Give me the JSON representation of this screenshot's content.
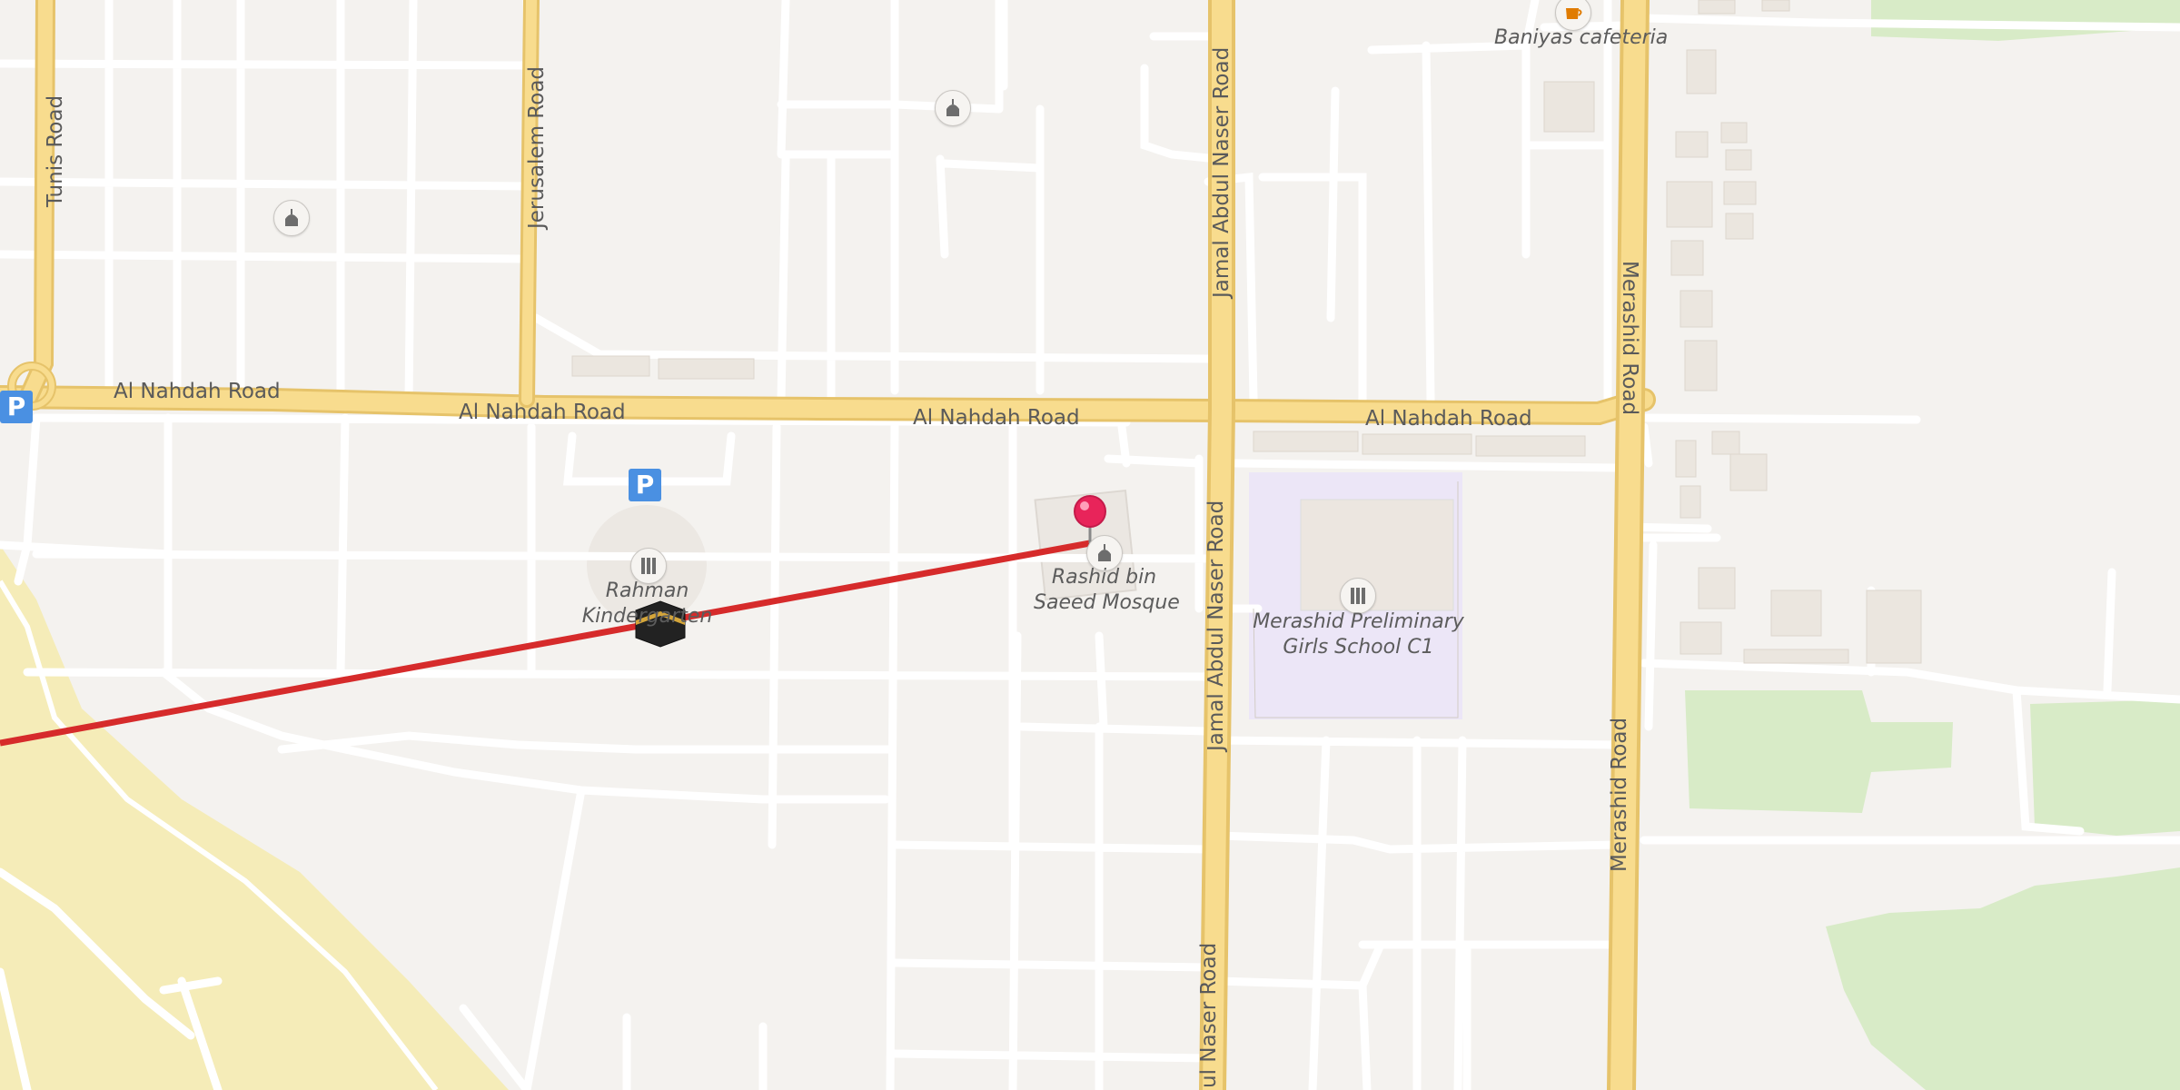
{
  "map": {
    "roads": {
      "al_nahdah_1": "Al Nahdah Road",
      "al_nahdah_2": "Al Nahdah Road",
      "al_nahdah_3": "Al Nahdah Road",
      "al_nahdah_4": "Al Nahdah Road",
      "tunis": "Tunis Road",
      "jerusalem": "Jerusalem Road",
      "jamal_top": "Jamal Abdul Naser Road",
      "jamal_mid": "Jamal Abdul Naser Road",
      "jamal_bottom": "ul Naser Road",
      "merashid_top": "Merashid Road",
      "merashid_bottom": "Merashid Road"
    },
    "pois": {
      "cafeteria": "Baniyas cafeteria",
      "mosque_line1": "Rashid bin",
      "mosque_line2": "Saeed Mosque",
      "school_line1": "Merashid Preliminary",
      "school_line2": "Girls School C1",
      "kindergarten_line1": "Rahman",
      "kindergarten_line2": "Kindergarten"
    },
    "parking_label": "P",
    "colors": {
      "background": "#f4f2ef",
      "major_road": "#f5d27a",
      "minor_road": "#ffffff",
      "route_line": "#d62b2b",
      "pin": "#e8245a",
      "park": "#d8ebc7",
      "desert": "#f5ecb8",
      "school_area": "#ece6f7"
    },
    "icons": [
      "mosque-icon",
      "school-icon",
      "cafe-icon",
      "parking-icon",
      "kaaba-icon",
      "map-pin-icon"
    ]
  }
}
